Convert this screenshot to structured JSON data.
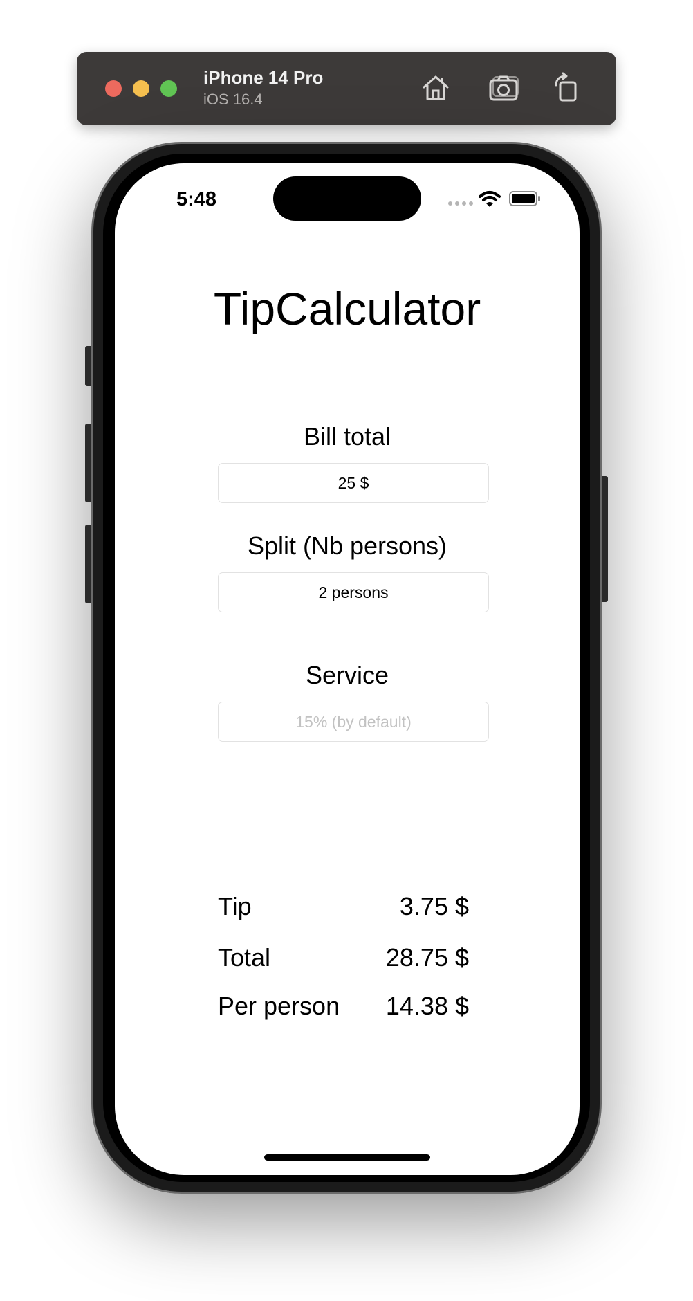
{
  "simulator": {
    "device_name": "iPhone 14 Pro",
    "os_version": "iOS 16.4",
    "buttons": [
      "home-icon",
      "screenshot-icon",
      "rotate-icon"
    ]
  },
  "status_bar": {
    "time": "5:48"
  },
  "app": {
    "title": "TipCalculator",
    "bill": {
      "label": "Bill total",
      "value": "25 $"
    },
    "split": {
      "label": "Split (Nb persons)",
      "value": "2 persons"
    },
    "service": {
      "label": "Service",
      "placeholder": "15% (by default)"
    },
    "results": [
      {
        "label": "Tip",
        "value": "3.75 $"
      },
      {
        "label": "Total",
        "value": "28.75 $"
      },
      {
        "label": "Per person",
        "value": "14.38 $"
      }
    ]
  },
  "colors": {
    "toolbar": "#3d3a39",
    "close": "#ed6a5e",
    "minimize": "#f5bf4f",
    "zoom": "#61c554",
    "placeholder": "#c2c2c2"
  }
}
